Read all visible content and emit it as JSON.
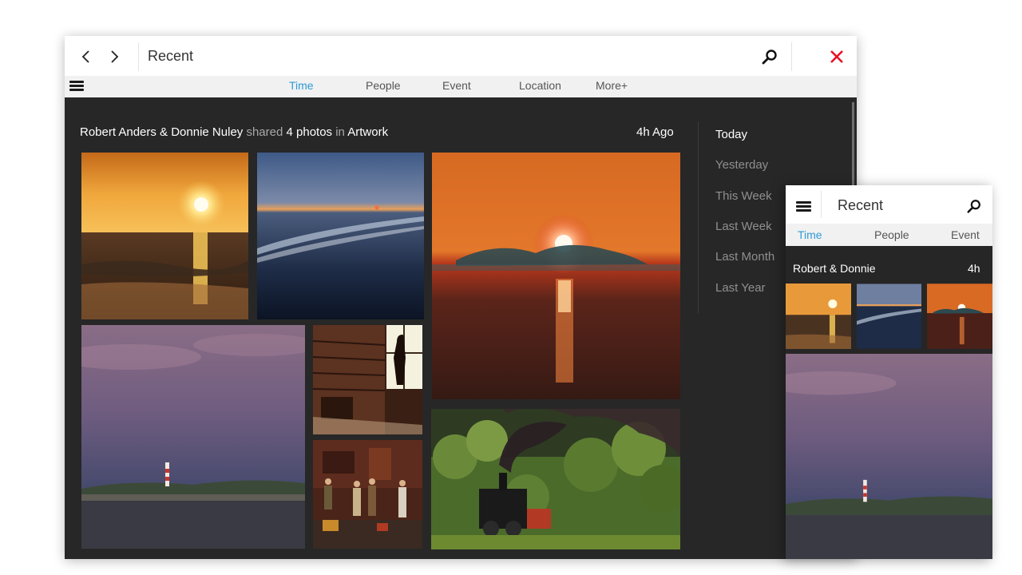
{
  "window": {
    "title": "Recent",
    "tabs": [
      {
        "label": "Time",
        "active": true
      },
      {
        "label": "People",
        "active": false
      },
      {
        "label": "Event",
        "active": false
      },
      {
        "label": "Location",
        "active": false
      },
      {
        "label": "More+",
        "active": false
      }
    ]
  },
  "post": {
    "author": "Robert Anders & Donnie Nuley",
    "verb": "shared",
    "count": "4 photos",
    "prep": "in",
    "album": "Artwork",
    "time": "4h Ago"
  },
  "timeline": [
    "Today",
    "Yesterday",
    "This Week",
    "Last Week",
    "Last Month",
    "Last Year"
  ],
  "mobile": {
    "title": "Recent",
    "tabs": [
      "Time",
      "People",
      "Event"
    ],
    "post_author": "Robert  & Donnie",
    "post_time": "4h"
  },
  "photos": [
    {
      "name": "sunset-beach"
    },
    {
      "name": "blue-shore"
    },
    {
      "name": "red-sun-splash"
    },
    {
      "name": "lighthouse-dusk"
    },
    {
      "name": "girl-window"
    },
    {
      "name": "train-travellers"
    },
    {
      "name": "steam-train"
    }
  ],
  "colors": {
    "accent": "#2e9bd6",
    "close": "#e81123",
    "content_bg": "#272727"
  }
}
